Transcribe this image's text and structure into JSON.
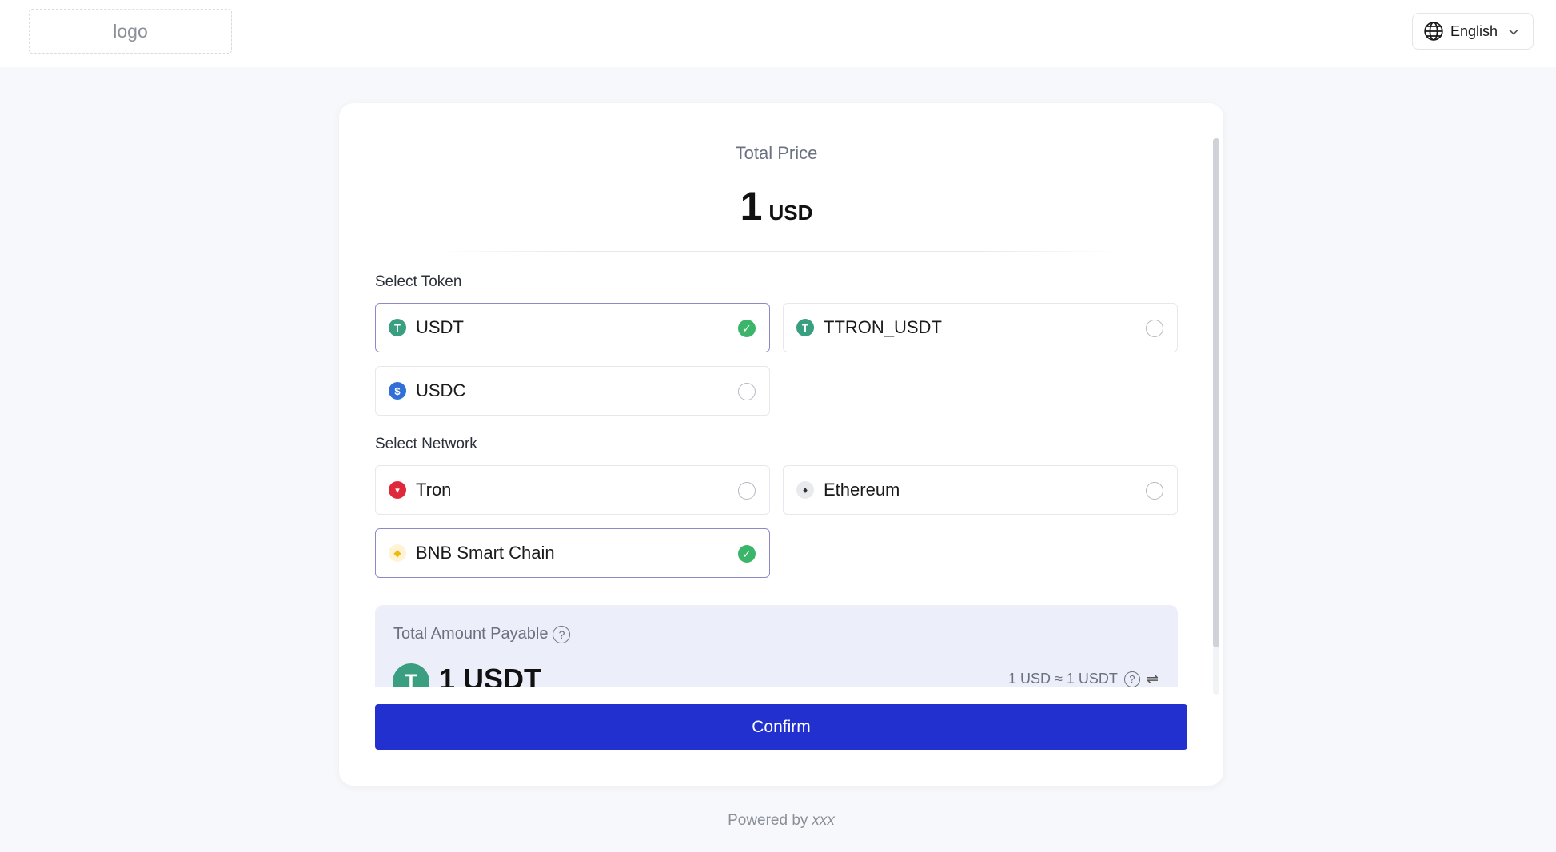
{
  "header": {
    "logo_text": "logo",
    "language": "English",
    "globe_icon": "globe-icon",
    "chevron_icon": "chevron-down-icon"
  },
  "price": {
    "label": "Total Price",
    "amount": "1",
    "currency": "USD"
  },
  "token": {
    "label": "Select Token",
    "options": [
      {
        "name": "USDT",
        "icon_letter": "T",
        "icon_color": "#3a9e80",
        "selected": true
      },
      {
        "name": "TTRON_USDT",
        "icon_letter": "T",
        "icon_color": "#3a9e80",
        "selected": false
      },
      {
        "name": "USDC",
        "icon_letter": "$",
        "icon_color": "#2f6fd6",
        "selected": false
      }
    ]
  },
  "network": {
    "label": "Select Network",
    "options": [
      {
        "name": "Tron",
        "icon_letter": "▾",
        "icon_color": "#e0283c",
        "selected": false
      },
      {
        "name": "Ethereum",
        "icon_letter": "♦",
        "icon_color": "#e9eaee",
        "selected": false
      },
      {
        "name": "BNB Smart Chain",
        "icon_letter": "◆",
        "icon_color": "#fff3d6",
        "selected": true
      }
    ]
  },
  "payable": {
    "label": "Total Amount Payable",
    "amount": "1 USDT",
    "coin_letter": "T",
    "rate": "1 USD ≈ 1 USDT",
    "help_symbol": "?",
    "swap_symbol": "⇌"
  },
  "confirm_label": "Confirm",
  "footer": {
    "prefix": "Powered by",
    "brand": "xxx"
  },
  "colors": {
    "accent": "#2330d0",
    "selected_border": "#8c89c9",
    "check": "#3bb56a",
    "payable_bg": "#eceef9"
  }
}
